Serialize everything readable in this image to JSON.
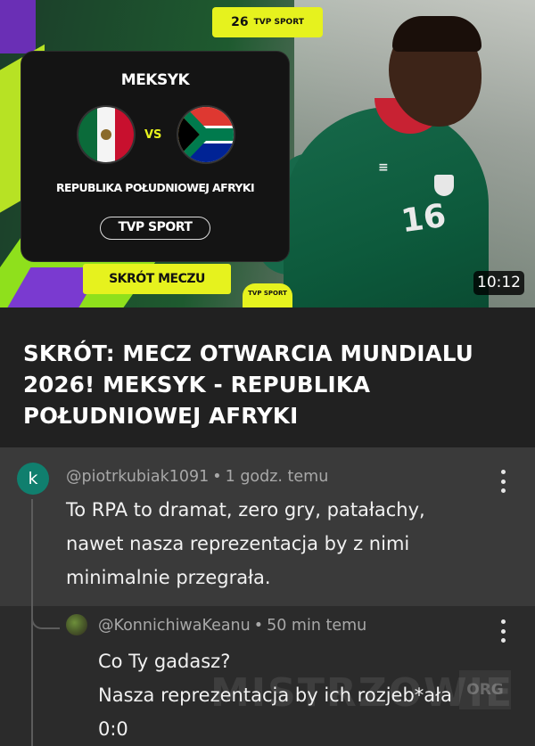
{
  "thumbnail": {
    "brand_tab_num": "26",
    "brand_tab_text": "TVP SPORT",
    "card_team1": "MEKSYK",
    "card_vs": "VS",
    "card_team2": "REPUBLIKA POŁUDNIOWEJ AFRYKI",
    "card_channel": "TVP SPORT",
    "tag": "SKRÓT MECZU",
    "bottom_logo": "TVP SPORT",
    "jersey_number": "16",
    "duration": "10:12"
  },
  "video": {
    "title": "SKRÓT: MECZ OTWARCIA MUNDIALU 2026! MEKSYK - REPUBLIKA POŁUDNIOWEJ AFRYKI"
  },
  "comments": [
    {
      "avatar_letter": "k",
      "author": "@piotrkubiak1091",
      "time": "1 godz. temu",
      "lines": [
        "To RPA to dramat, zero gry, patałachy,",
        "nawet nasza reprezentacja by z nimi",
        "minimalnie przegrała."
      ]
    },
    {
      "author": "@KonnichiwaKeanu",
      "time": "50 min temu",
      "lines": [
        "Co Ty gadasz?",
        "Nasza reprezentacja by ich rozjeb*ała",
        "0:0"
      ]
    }
  ],
  "watermark": {
    "text": "MISTRZOWIE",
    "suffix": "ORG"
  },
  "colors": {
    "background": "#212121",
    "comment_bg": "#3a3a3a",
    "reply_bg": "#2b2b2b",
    "accent_yellow": "#e6f21e",
    "avatar_teal": "#107f6e"
  }
}
